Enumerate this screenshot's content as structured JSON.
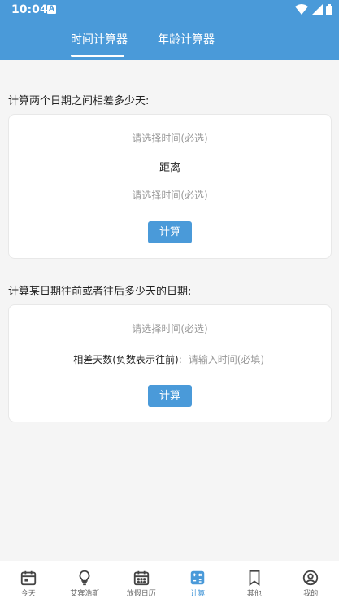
{
  "status_bar": {
    "time": "10:04",
    "notification_letter": "A"
  },
  "tabs": [
    {
      "label": "时间计算器",
      "active": true
    },
    {
      "label": "年龄计算器",
      "active": false
    }
  ],
  "section1": {
    "title": "计算两个日期之间相差多少天:",
    "start_placeholder": "请选择时间(必选)",
    "distance_label": "距离",
    "end_placeholder": "请选择时间(必选)",
    "button_label": "计算"
  },
  "section2": {
    "title": "计算某日期往前或者往后多少天的日期:",
    "date_placeholder": "请选择时间(必选)",
    "diff_label": "相差天数(负数表示往前):",
    "diff_placeholder": "请输入时间(必填)",
    "button_label": "计算"
  },
  "bottom_nav": [
    {
      "label": "今天",
      "icon": "calendar-icon",
      "active": false
    },
    {
      "label": "艾宾浩斯",
      "icon": "lightbulb-icon",
      "active": false
    },
    {
      "label": "放假日历",
      "icon": "calendar-grid-icon",
      "active": false
    },
    {
      "label": "计算",
      "icon": "calculator-icon",
      "active": true
    },
    {
      "label": "其他",
      "icon": "bookmark-icon",
      "active": false
    },
    {
      "label": "我的",
      "icon": "user-icon",
      "active": false
    }
  ],
  "colors": {
    "primary": "#4a9ad9",
    "background": "#f5f5f5",
    "card": "#ffffff",
    "muted_text": "#999999"
  }
}
